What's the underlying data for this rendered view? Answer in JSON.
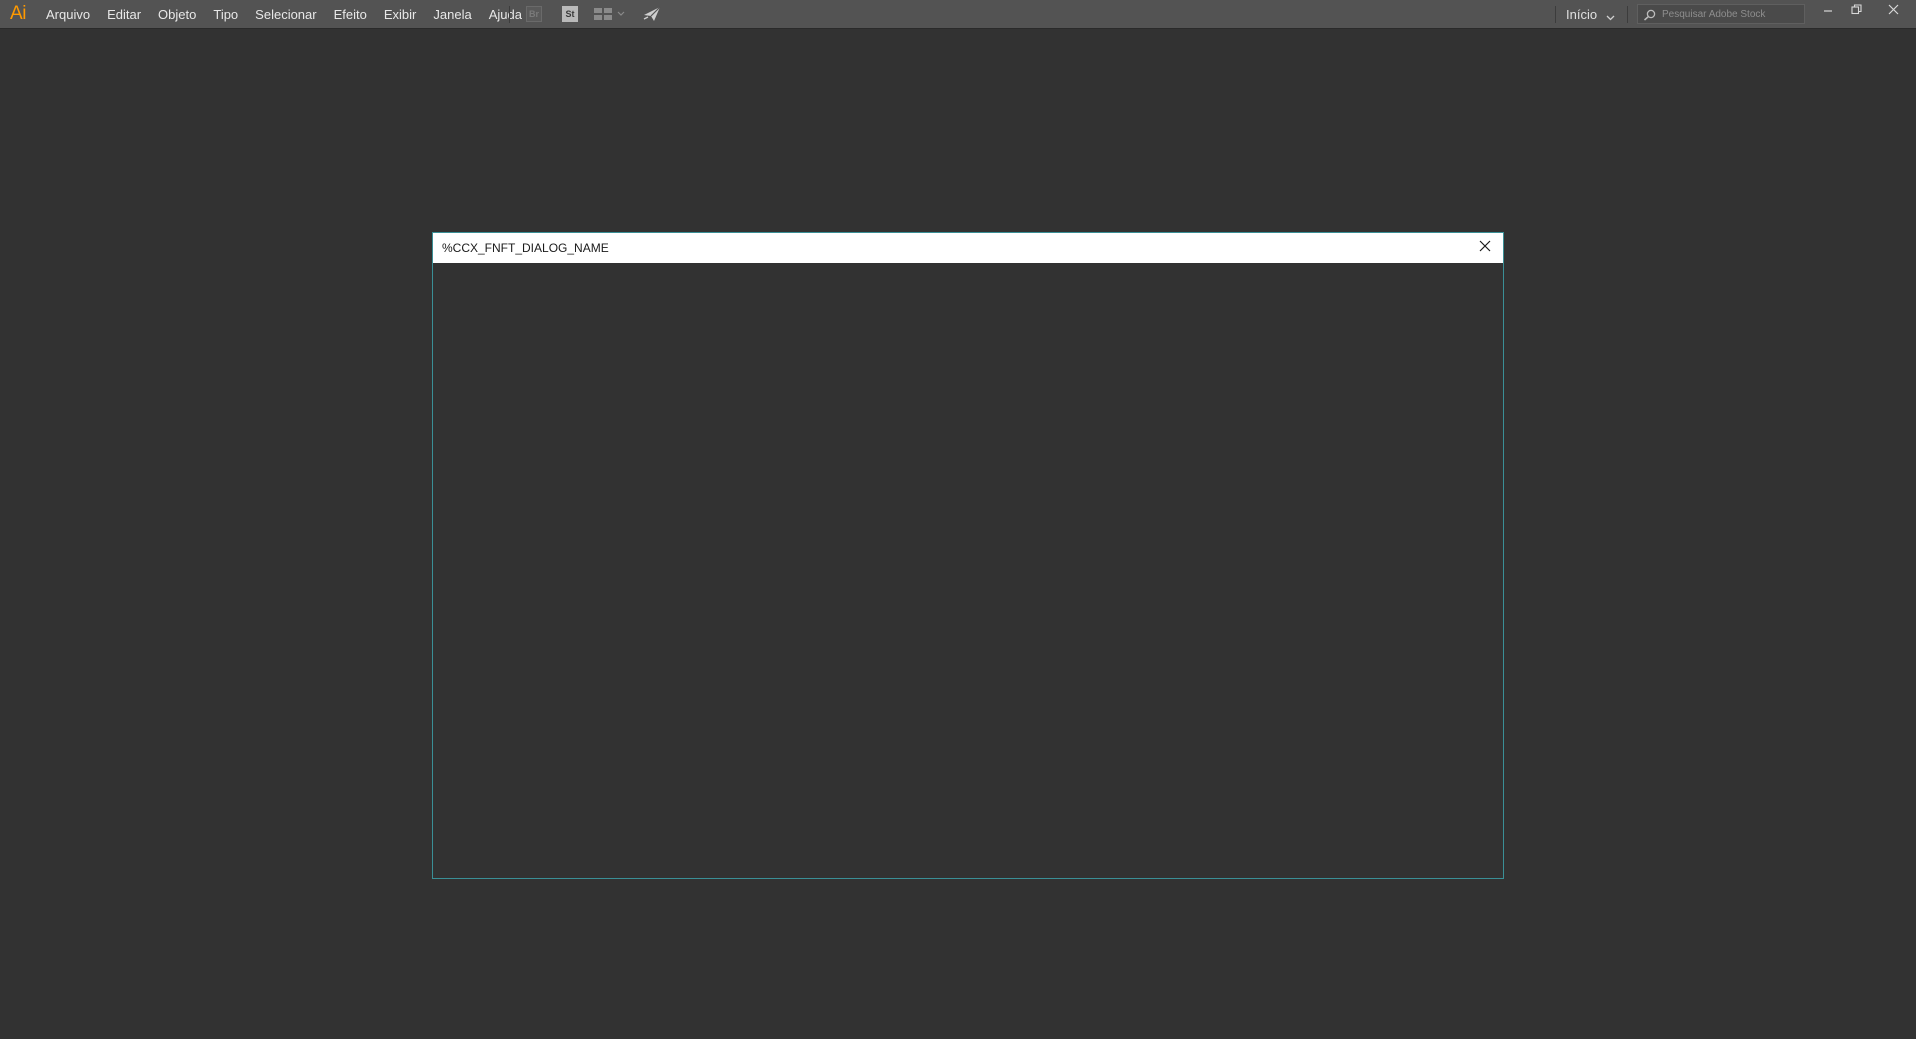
{
  "app": {
    "logo_text": "Ai",
    "accent_color": "#ff9a00"
  },
  "menu": {
    "items": [
      {
        "label": "Arquivo"
      },
      {
        "label": "Editar"
      },
      {
        "label": "Objeto"
      },
      {
        "label": "Tipo"
      },
      {
        "label": "Selecionar"
      },
      {
        "label": "Efeito"
      },
      {
        "label": "Exibir"
      },
      {
        "label": "Janela"
      },
      {
        "label": "Ajuda"
      }
    ]
  },
  "toolbar": {
    "bridge_label": "Br",
    "stock_label": "St",
    "icons": [
      "bridge-icon",
      "stock-icon",
      "arrange-documents-icon",
      "chevron-down-icon",
      "sync-send-icon"
    ]
  },
  "workspace": {
    "label": "Início"
  },
  "search": {
    "placeholder": "Pesquisar Adobe Stock",
    "value": ""
  },
  "window_controls": [
    "minimize-icon",
    "restore-icon",
    "close-icon"
  ],
  "dialog": {
    "title": "%CCX_FNFT_DIALOG_NAME",
    "border_color": "#3a8f96"
  }
}
